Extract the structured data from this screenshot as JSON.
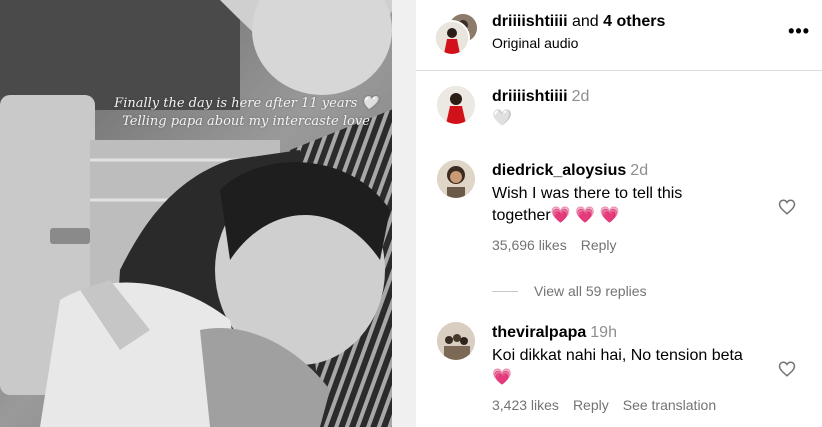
{
  "media": {
    "caption_line1": "Finally the day is here after 11 years",
    "caption_line2": "Telling papa about my intercaste love",
    "heart": "🤍"
  },
  "header": {
    "username": "driiiishtiiii",
    "and_text": " and ",
    "others": "4 others",
    "subtitle": "Original audio",
    "more_icon": "•••"
  },
  "comments": [
    {
      "username": "driiiishtiiii",
      "time": "2d",
      "text": "🤍"
    },
    {
      "username": "diedrick_aloysius",
      "time": "2d",
      "text_line1": "Wish I was there to tell this",
      "text_line2": "together",
      "emoji": "💗 💗 💗",
      "likes": "35,696 likes",
      "reply": "Reply"
    },
    {
      "username": "theviralpapa",
      "time": "19h",
      "text_line1": "Koi dikkat nahi hai, No tension beta",
      "emoji": "💗",
      "likes": "3,423 likes",
      "reply": "Reply",
      "translate": "See translation"
    }
  ],
  "view_replies": "View all 59 replies",
  "colors": {
    "muted": "#737373",
    "heart_pink": "#ff2a69",
    "divider": "#dbdbdb"
  }
}
